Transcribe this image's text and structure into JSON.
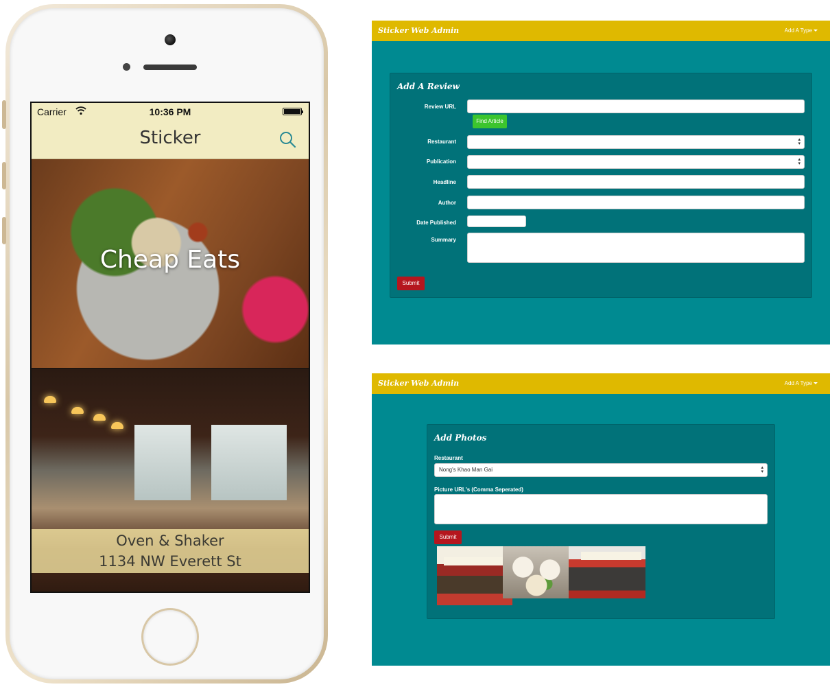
{
  "phone": {
    "status": {
      "carrier": "Carrier",
      "time": "10:36 PM"
    },
    "nav": {
      "title": "Sticker"
    },
    "cards": [
      {
        "label": "Cheap Eats"
      },
      {
        "name": "Oven & Shaker",
        "address": "1134 NW Everett St"
      }
    ]
  },
  "admin_review": {
    "brand": "Sticker Web Admin",
    "menu": "Add A Type",
    "heading": "Add A Review",
    "labels": {
      "review_url": "Review URL",
      "restaurant": "Restaurant",
      "publication": "Publication",
      "headline": "Headline",
      "author": "Author",
      "date_published": "Date Published",
      "summary": "Summary"
    },
    "find_article": "Find Article",
    "submit": "Submit"
  },
  "admin_photos": {
    "brand": "Sticker Web Admin",
    "menu": "Add A Type",
    "heading": "Add Photos",
    "restaurant_label": "Restaurant",
    "restaurant_value": "Nong's Khao Man Gai",
    "urls_label": "Picture URL's (Comma Seperated)",
    "submit": "Submit"
  },
  "colors": {
    "admin_bg": "#008a91",
    "admin_topbar": "#dfb900",
    "phone_bar": "#f2ecc2",
    "find_button": "#3cc52e",
    "submit_button": "#b5161e"
  }
}
